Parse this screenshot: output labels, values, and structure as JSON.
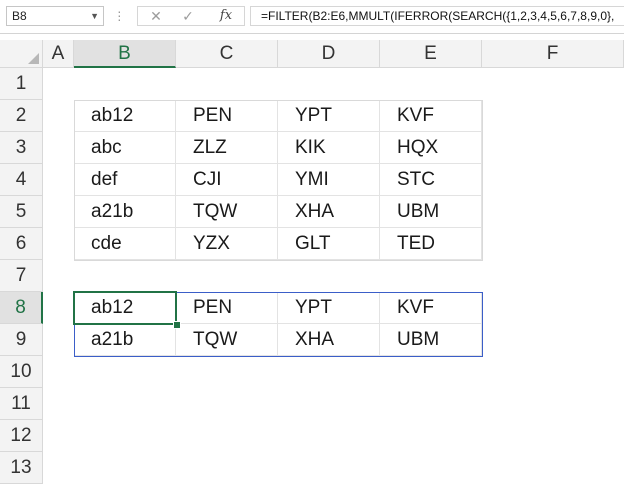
{
  "formula_bar": {
    "name_box": "B8",
    "cancel_glyph": "✕",
    "enter_glyph": "✓",
    "fx_label": "fx",
    "formula": "=FILTER(B2:E6,MMULT(IFERROR(SEARCH({1,2,3,4,5,6,7,8,9,0},"
  },
  "columns": [
    "A",
    "B",
    "C",
    "D",
    "E",
    "F"
  ],
  "active_column": "B",
  "rows": [
    "1",
    "2",
    "3",
    "4",
    "5",
    "6",
    "7",
    "8",
    "9",
    "10",
    "11",
    "12",
    "13"
  ],
  "active_row": "8",
  "source_table": [
    [
      "ab12",
      "PEN",
      "YPT",
      "KVF"
    ],
    [
      "abc",
      "ZLZ",
      "KIK",
      "HQX"
    ],
    [
      "def",
      "CJI",
      "YMI",
      "STC"
    ],
    [
      "a21b",
      "TQW",
      "XHA",
      "UBM"
    ],
    [
      "cde",
      "YZX",
      "GLT",
      "TED"
    ]
  ],
  "result_table": [
    [
      "ab12",
      "PEN",
      "YPT",
      "KVF"
    ],
    [
      "a21b",
      "TQW",
      "XHA",
      "UBM"
    ]
  ],
  "colors": {
    "accent_green": "#217346",
    "spill_border": "#3b5ec8"
  }
}
